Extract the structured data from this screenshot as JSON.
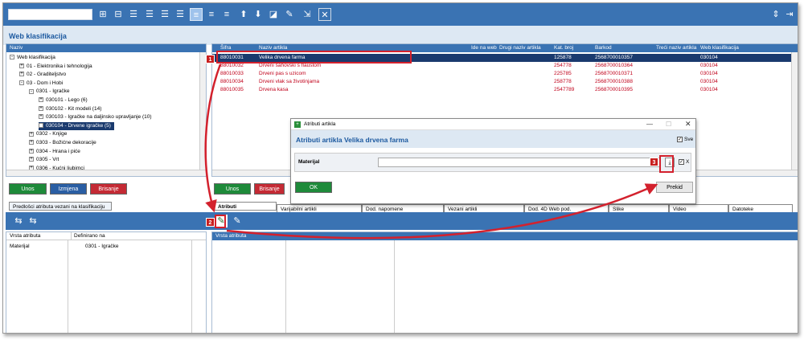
{
  "toolbar": {
    "search_value": ""
  },
  "window_title": "Web klasifikacija",
  "tree": {
    "header": "Naziv",
    "items": [
      {
        "label": "Web klasifikacija",
        "level": 0,
        "sign": "-"
      },
      {
        "label": "01 - Elektronika i tehnologija",
        "level": 1,
        "sign": "+"
      },
      {
        "label": "02 - Graditeljstvo",
        "level": 1,
        "sign": "+"
      },
      {
        "label": "03 - Dom i Hobi",
        "level": 1,
        "sign": "-"
      },
      {
        "label": "0301 - Igračke",
        "level": 2,
        "sign": "-"
      },
      {
        "label": "030101 - Lego (6)",
        "level": 3,
        "sign": "+"
      },
      {
        "label": "030102 - Kit modeli (14)",
        "level": 3,
        "sign": "+"
      },
      {
        "label": "030103 - Igračke na daljinsko upravljanje (10)",
        "level": 3,
        "sign": "+"
      },
      {
        "label": "030104 - Drvene igračke (5)",
        "level": 3,
        "sign": "+",
        "selected": true
      },
      {
        "label": "0302 - Knjige",
        "level": 2,
        "sign": "+"
      },
      {
        "label": "0303 - Božićne dekoracije",
        "level": 2,
        "sign": "+"
      },
      {
        "label": "0304 - Hrana i piće",
        "level": 2,
        "sign": "+"
      },
      {
        "label": "0305 - Vrt",
        "level": 2,
        "sign": "+"
      },
      {
        "label": "0306 - Kućni ljubimci",
        "level": 2,
        "sign": "+"
      }
    ],
    "buttons": {
      "unos": "Unos",
      "izmjena": "Izmjena",
      "brisanje": "Brisanje"
    }
  },
  "grid": {
    "columns": [
      "Šifra",
      "Naziv artikla",
      "Ide na web",
      "Drugi naziv artikla",
      "Kat. broj",
      "Barkod",
      "Treći naziv artikla",
      "Web klasifikacija"
    ],
    "rows": [
      {
        "sifra": "88010031",
        "naziv": "Velika drvena farma",
        "kat": "125878",
        "barkod": "2568700010357",
        "web": "030104",
        "selected": true
      },
      {
        "sifra": "88010032",
        "naziv": "Drveni šahovski s flaustom",
        "kat": "254778",
        "barkod": "2568700010364",
        "web": "030104"
      },
      {
        "sifra": "88010033",
        "naziv": "Drveni pas s uzicom",
        "kat": "225785",
        "barkod": "2568700010371",
        "web": "030104"
      },
      {
        "sifra": "88010034",
        "naziv": "Drveni vlak sa životinjama",
        "kat": "258778",
        "barkod": "2568700010388",
        "web": "030104"
      },
      {
        "sifra": "88010035",
        "naziv": "Drvena kasa",
        "kat": "2547789",
        "barkod": "2568700010395",
        "web": "030104"
      }
    ],
    "buttons": {
      "unos": "Unos",
      "brisanje": "Brisanje"
    }
  },
  "left_bottom": {
    "tab": "Predlošci atributa vezani na klasifikaciju",
    "columns": [
      "Vrsta atributa",
      "Definirano na"
    ],
    "rows": [
      {
        "vrsta": "Materijal",
        "definirano": "0301 - Igračke"
      }
    ]
  },
  "right_bottom": {
    "tabs": [
      "Atributi",
      "Varijabilni artikli",
      "Dod. napomene",
      "Vezani artikli",
      "Dod. 4D Web pod.",
      "Slike",
      "Video",
      "Datoteke"
    ],
    "columns": [
      "Vrsta atributa"
    ]
  },
  "dialog": {
    "window_title": "Atributi artikla",
    "heading": "Atributi artikla Velika drvena farma",
    "sve_label": "Sve",
    "field_label": "Materijal",
    "field_value": "",
    "x_label": "X",
    "ok": "OK",
    "prekid": "Prekid"
  },
  "callouts": [
    "1",
    "2",
    "3"
  ],
  "colors": {
    "accent": "#3a73b3",
    "selected": "#1a3a6e",
    "red_text": "#c0001a",
    "annotation": "#d3212d"
  }
}
